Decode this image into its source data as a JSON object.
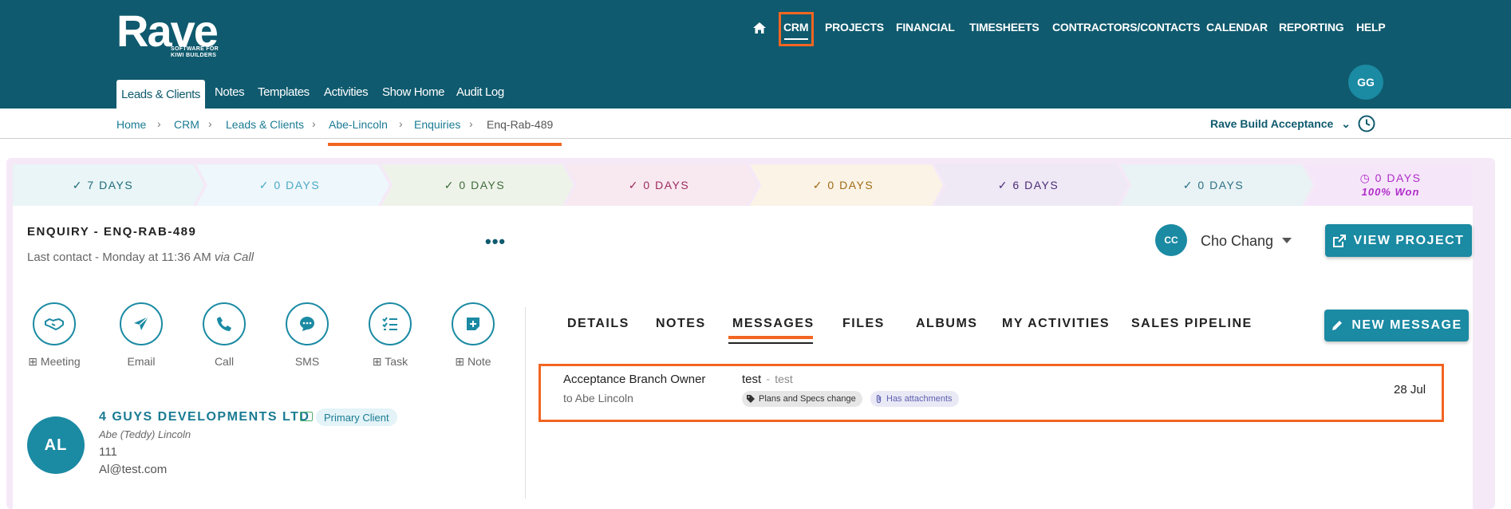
{
  "brand": {
    "name": "Rave",
    "tagline": "SOFTWARE FOR KIWI BUILDERS"
  },
  "topnav": [
    "CRM",
    "PROJECTS",
    "FINANCIAL",
    "TIMESHEETS",
    "CONTRACTORS/CONTACTS",
    "CALENDAR",
    "REPORTING",
    "HELP"
  ],
  "user": {
    "initials": "GG"
  },
  "subnav": [
    "Leads & Clients",
    "Notes",
    "Templates",
    "Activities",
    "Show Home",
    "Audit Log"
  ],
  "breadcrumb": [
    "Home",
    "CRM",
    "Leads & Clients",
    "Abe-Lincoln",
    "Enquiries",
    "Enq-Rab-489"
  ],
  "stage_select": "Rave Build Acceptance",
  "stages": [
    {
      "label": "✓ 7 DAYS",
      "color": "#1f6b7c",
      "bg": "#e9f5f6"
    },
    {
      "label": "✓ 0 DAYS",
      "color": "#4aa8c6",
      "bg": "#eef7fb"
    },
    {
      "label": "✓ 0 DAYS",
      "color": "#3f6b3a",
      "bg": "#eef3ea"
    },
    {
      "label": "✓ 0 DAYS",
      "color": "#9c2b5f",
      "bg": "#f8e9f0"
    },
    {
      "label": "✓ 0 DAYS",
      "color": "#a26b15",
      "bg": "#faf3e6"
    },
    {
      "label": "✓ 6 DAYS",
      "color": "#4b2c78",
      "bg": "#efe8f5"
    },
    {
      "label": "✓ 0 DAYS",
      "color": "#2b7185",
      "bg": "#e9f2f4"
    },
    {
      "label": "◷ 0 DAYS",
      "sub": "100% Won",
      "color": "#b02cc8",
      "bg": "#f6e6fa"
    }
  ],
  "enquiry": {
    "title": "ENQUIRY - ENQ-RAB-489",
    "last_contact": "Last contact - Monday at 11:36 AM",
    "via": "via Call"
  },
  "owner": {
    "initials": "CC",
    "name": "Cho Chang"
  },
  "view_project_label": "VIEW PROJECT",
  "actions": [
    {
      "label": "Meeting",
      "prefix": "⊞ ",
      "icon": "handshake-icon"
    },
    {
      "label": "Email",
      "prefix": "",
      "icon": "send-icon"
    },
    {
      "label": "Call",
      "prefix": "",
      "icon": "phone-icon"
    },
    {
      "label": "SMS",
      "prefix": "",
      "icon": "sms-icon"
    },
    {
      "label": "Task",
      "prefix": "⊞ ",
      "icon": "checklist-icon"
    },
    {
      "label": "Note",
      "prefix": "⊞ ",
      "icon": "note-plus-icon"
    }
  ],
  "client": {
    "initials": "AL",
    "company": "4 GUYS DEVELOPMENTS LTD",
    "badge": "Primary Client",
    "contact_name": "Abe (Teddy) Lincoln",
    "phone": "111",
    "email": "Al@test.com"
  },
  "tabs": [
    "DETAILS",
    "NOTES",
    "MESSAGES",
    "FILES",
    "ALBUMS",
    "MY ACTIVITIES",
    "SALES PIPELINE"
  ],
  "active_tab": "MESSAGES",
  "new_message_label": "NEW MESSAGE",
  "message": {
    "sender": "Acceptance Branch Owner",
    "recipient": "to Abe Lincoln",
    "subject": "test",
    "preview": "test",
    "tag": "Plans and Specs change",
    "attachments": "Has attachments",
    "date": "28 Jul"
  },
  "colors": {
    "header": "#0f5a6e",
    "accent": "#1b8aa3",
    "highlight": "#f26522"
  }
}
